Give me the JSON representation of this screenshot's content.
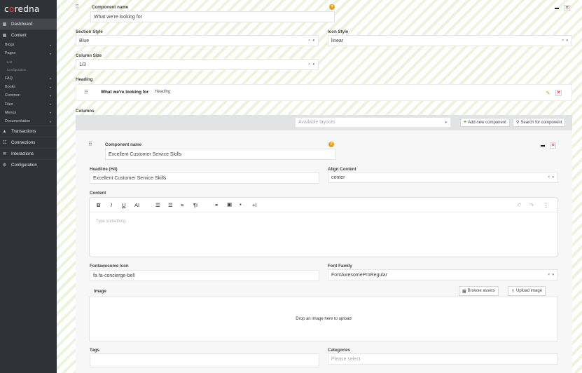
{
  "brand": {
    "prefix": "c",
    "accent": "o",
    "suffix": "redna"
  },
  "sidebar": {
    "dashboard": "Dashboard",
    "content": "Content",
    "sub_items": [
      {
        "label": "Blogs"
      },
      {
        "label": "Pages"
      },
      {
        "label": "List"
      },
      {
        "label": "Configuration"
      },
      {
        "label": "FAQ"
      },
      {
        "label": "Books"
      },
      {
        "label": "Common"
      },
      {
        "label": "Files"
      },
      {
        "label": "Menus"
      },
      {
        "label": "Documentation"
      }
    ],
    "transactions": "Transactions",
    "connections": "Connections",
    "interactions": "Interactions",
    "configuration": "Configuration"
  },
  "section": {
    "component_name_label": "Component name",
    "component_name_value": "What we're looking for",
    "section_style_label": "Section Style",
    "section_style_value": "Blue",
    "icon_style_label": "Icon Style",
    "icon_style_value": "linear",
    "column_size_label": "Column Size",
    "column_size_value": "1/3",
    "heading_label": "Heading",
    "heading_item_title": "What we're looking for",
    "heading_item_type": "Heading",
    "columns_label": "Columns",
    "available_layouts_placeholder": "Available layouts",
    "add_new_component": "Add new component",
    "search_for_component": "Search for component"
  },
  "inner": {
    "component_name_label": "Component name",
    "component_name_value": "Excellent Customer Service Skills",
    "headline_label": "Headline (H4)",
    "headline_value": "Excellent Customer Service Skills",
    "align_content_label": "Align Content",
    "align_content_value": "center",
    "content_label": "Content",
    "editor_placeholder": "Type something",
    "fontawesome_icon_label": "Fontawesome Icon",
    "fontawesome_icon_value": "fa fa-concierge-bell",
    "font_family_label": "Font Family",
    "font_family_value": "FontAwesomeProRegular",
    "image_label": "Image",
    "browse_assets": "Browse assets",
    "upload_image": "Upload image",
    "dropzone_text": "Drop an image here to upload",
    "tags_label": "Tags",
    "categories_label": "Categories",
    "categories_placeholder": "Please select"
  },
  "toolbar_glyphs": {
    "bold": "B",
    "italic": "I",
    "underline": "U",
    "font_size": "AI",
    "heading": "¶I",
    "indent": "+I",
    "more": "⋮",
    "undo": "↶",
    "redo": "↷"
  },
  "glyphs": {
    "drag": "⠿",
    "help": "?",
    "close": "✕",
    "pencil": "✎",
    "plus": "+",
    "search": "⚲",
    "upload": "⇧",
    "select_ctl": "× ▾",
    "caret": "▾"
  },
  "colors": {
    "sidebar_bg": "#2f3237",
    "accent_red": "#e8473e",
    "help_orange": "#e3a11b",
    "close_red": "#d9232d",
    "add_green": "#5aa02c"
  }
}
